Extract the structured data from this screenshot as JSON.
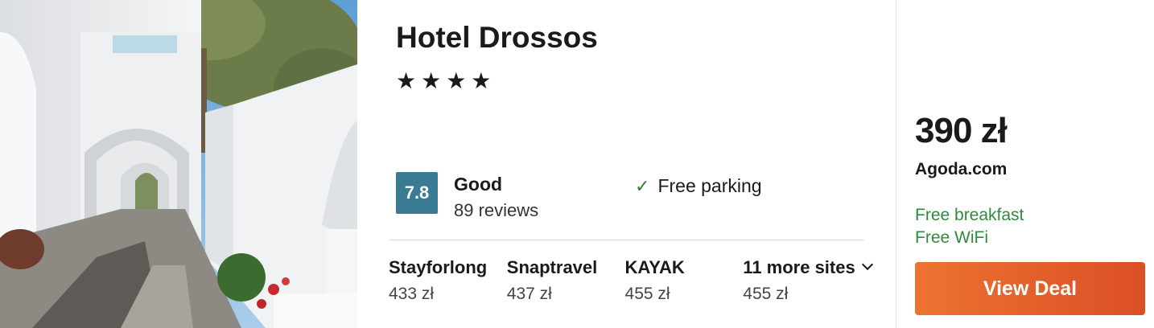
{
  "hotel": {
    "name": "Hotel Drossos",
    "stars_text": "★★★★",
    "star_count": 4
  },
  "rating": {
    "score": "7.8",
    "label": "Good",
    "reviews": "89 reviews",
    "badge_color": "#3a7b94"
  },
  "amenities": [
    {
      "icon": "check-icon",
      "label": "Free parking"
    }
  ],
  "other_sites": [
    {
      "name": "Stayforlong",
      "price": "433 zł"
    },
    {
      "name": "Snaptravel",
      "price": "437 zł"
    },
    {
      "name": "KAYAK",
      "price": "455 zł"
    },
    {
      "name": "11 more sites",
      "price": "455 zł",
      "icon": "chevron-down-icon"
    }
  ],
  "deal": {
    "price": "390 zł",
    "provider": "Agoda.com",
    "perks": [
      "Free breakfast",
      "Free WiFi"
    ],
    "perk_color": "#2e8a3c",
    "button_label": "View Deal",
    "button_color": "#e4602b"
  }
}
